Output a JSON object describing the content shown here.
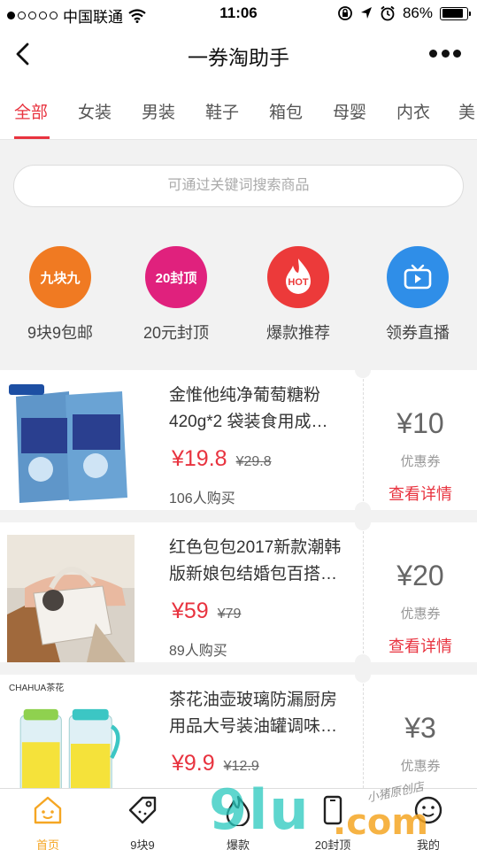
{
  "status_bar": {
    "carrier": "中国联通",
    "time": "11:06",
    "battery": "86%",
    "battery_level": 0.86
  },
  "nav": {
    "title": "一券淘助手"
  },
  "tabs": [
    "全部",
    "女装",
    "男装",
    "鞋子",
    "箱包",
    "母婴",
    "内衣",
    "美"
  ],
  "search": {
    "placeholder": "可通过关键词搜索商品"
  },
  "quick_links": [
    {
      "label": "9块9包邮",
      "badge": "九块九",
      "color": "#f07a22"
    },
    {
      "label": "20元封顶",
      "badge": "20封顶",
      "color": "#e0217d"
    },
    {
      "label": "爆款推荐",
      "badge": "HOT",
      "color": "#ec3a3a"
    },
    {
      "label": "领券直播",
      "badge": "",
      "color": "#2f8ee8"
    }
  ],
  "products": [
    {
      "title": "金惟他纯净葡萄糖粉420g*2 袋装食用成…",
      "title_lines": [
        "金惟他纯净葡萄糖粉",
        "420g*2 袋装食用成…"
      ],
      "price": "¥19.8",
      "old_price": "¥29.8",
      "buyers": "106人购买",
      "coupon": "¥10",
      "coupon_label": "优惠券",
      "detail_link": "查看详情"
    },
    {
      "title": "红色包包2017新款潮韩版新娘包结婚包百搭…",
      "title_lines": [
        "红色包包2017新款潮韩",
        "版新娘包结婚包百搭…"
      ],
      "price": "¥59",
      "old_price": "¥79",
      "buyers": "89人购买",
      "coupon": "¥20",
      "coupon_label": "优惠券",
      "detail_link": "查看详情"
    },
    {
      "title": "茶花油壶玻璃防漏厨房用品大号装油罐调味…",
      "title_lines": [
        "茶花油壶玻璃防漏厨房",
        "用品大号装油罐调味…"
      ],
      "price": "¥9.9",
      "old_price": "¥12.9",
      "buyers": "",
      "coupon": "¥3",
      "coupon_label": "优惠券",
      "detail_link": "",
      "brand_label": "CHAHUA茶花"
    }
  ],
  "bottom_nav": [
    {
      "label": "首页",
      "active": true
    },
    {
      "label": "9块9",
      "active": false
    },
    {
      "label": "爆款",
      "active": false
    },
    {
      "label": "20封顶",
      "active": false
    },
    {
      "label": "我的",
      "active": false
    }
  ],
  "watermark": {
    "logo": "9lu",
    "suffix": ".com",
    "script": "小猪原创店"
  }
}
